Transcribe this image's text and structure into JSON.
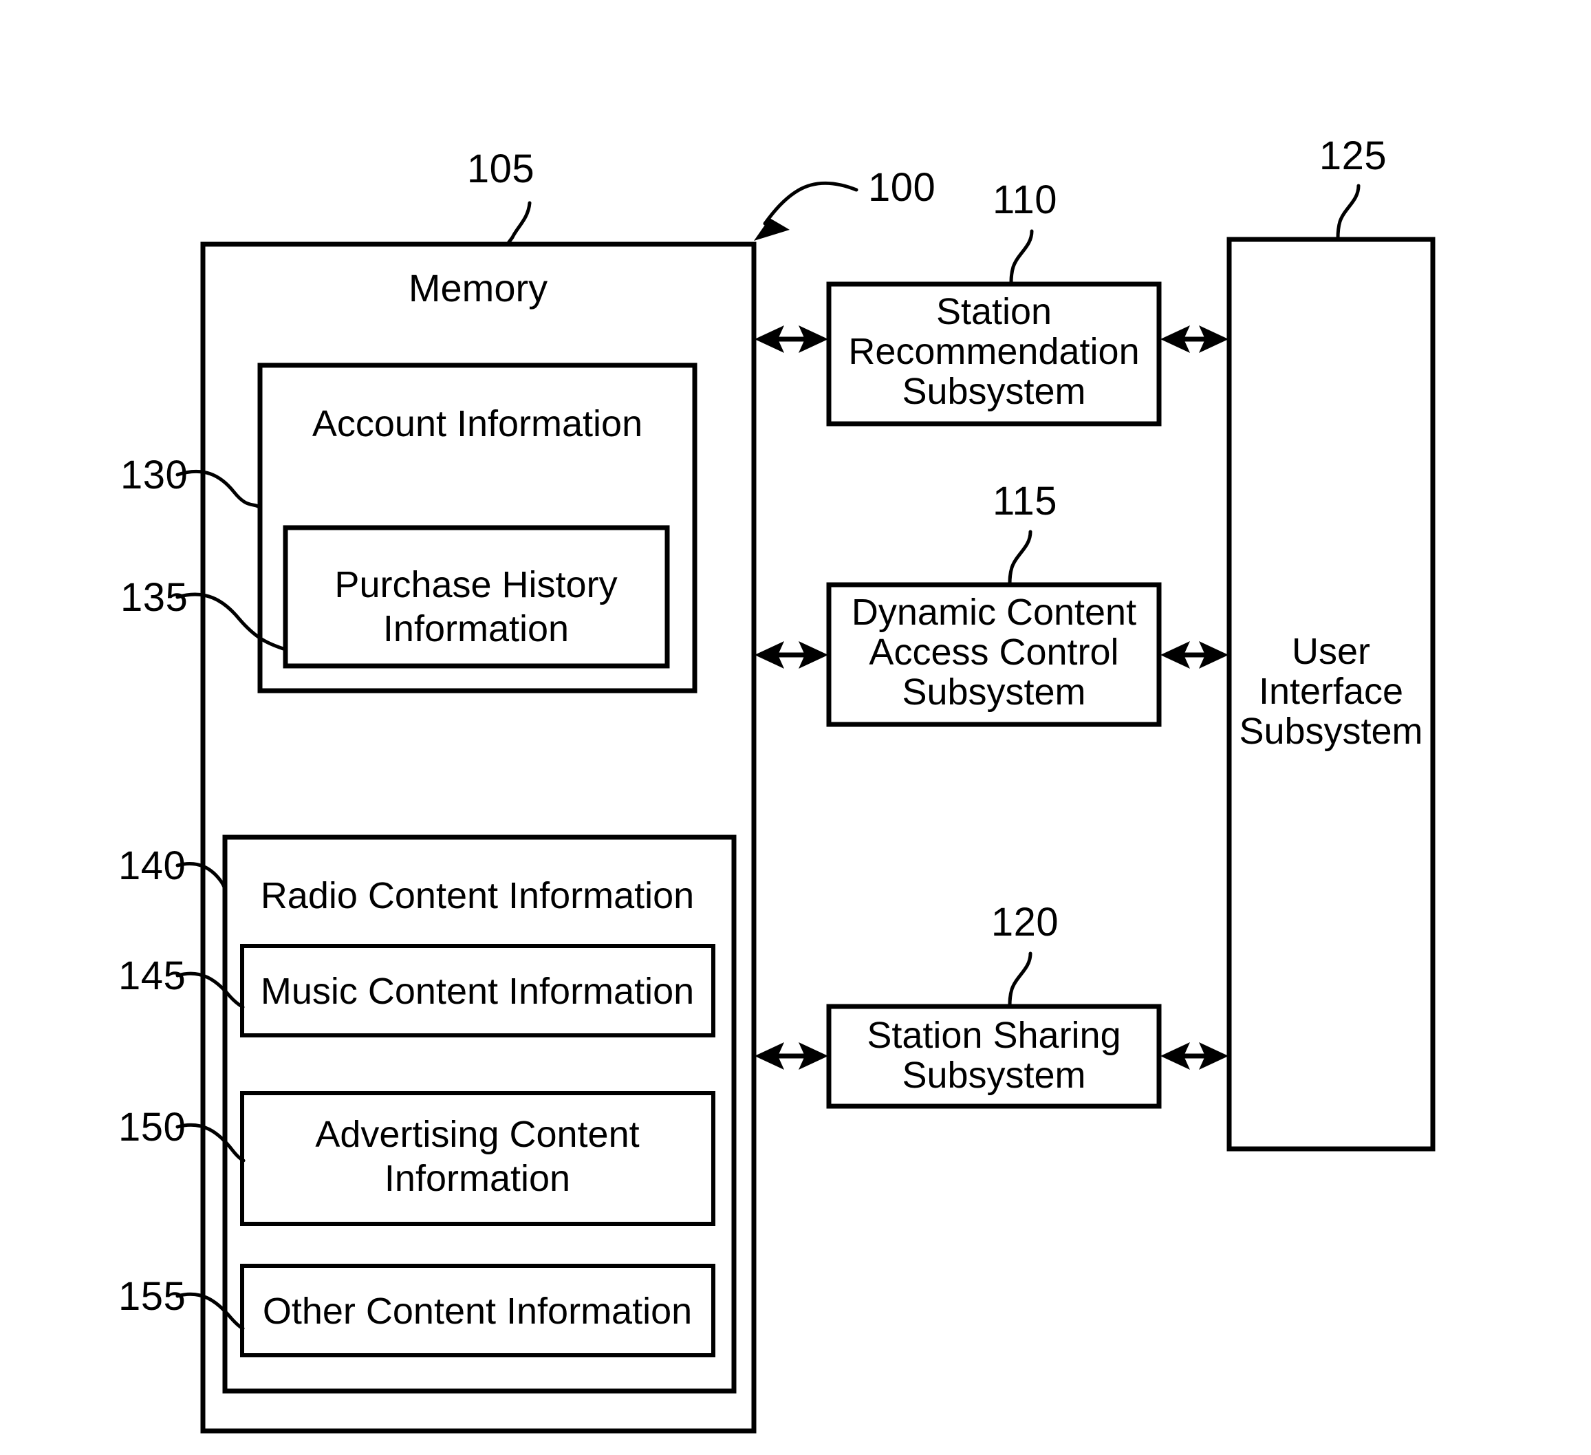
{
  "figure": {
    "system_ref": "100"
  },
  "memory": {
    "ref": "105",
    "title": "Memory",
    "account_information": {
      "ref": "130",
      "title": "Account Information",
      "purchase_history": {
        "ref": "135",
        "line1": "Purchase History",
        "line2": "Information"
      }
    },
    "radio_content_information": {
      "ref": "140",
      "title": "Radio Content Information",
      "music_content": {
        "ref": "145",
        "title": "Music Content Information"
      },
      "advertising_content": {
        "ref": "150",
        "line1": "Advertising Content",
        "line2": "Information"
      },
      "other_content": {
        "ref": "155",
        "title": "Other Content Information"
      }
    }
  },
  "subsystems": [
    {
      "ref": "110",
      "line1": "Station",
      "line2": "Recommendation",
      "line3": "Subsystem"
    },
    {
      "ref": "115",
      "line1": "Dynamic Content",
      "line2": "Access Control",
      "line3": "Subsystem"
    },
    {
      "ref": "120",
      "line1": "Station Sharing",
      "line2": "Subsystem",
      "line3": ""
    }
  ],
  "user_interface": {
    "ref": "125",
    "line1": "User",
    "line2": "Interface",
    "line3": "Subsystem"
  },
  "colors": {
    "stroke": "#000000",
    "background": "#ffffff"
  }
}
